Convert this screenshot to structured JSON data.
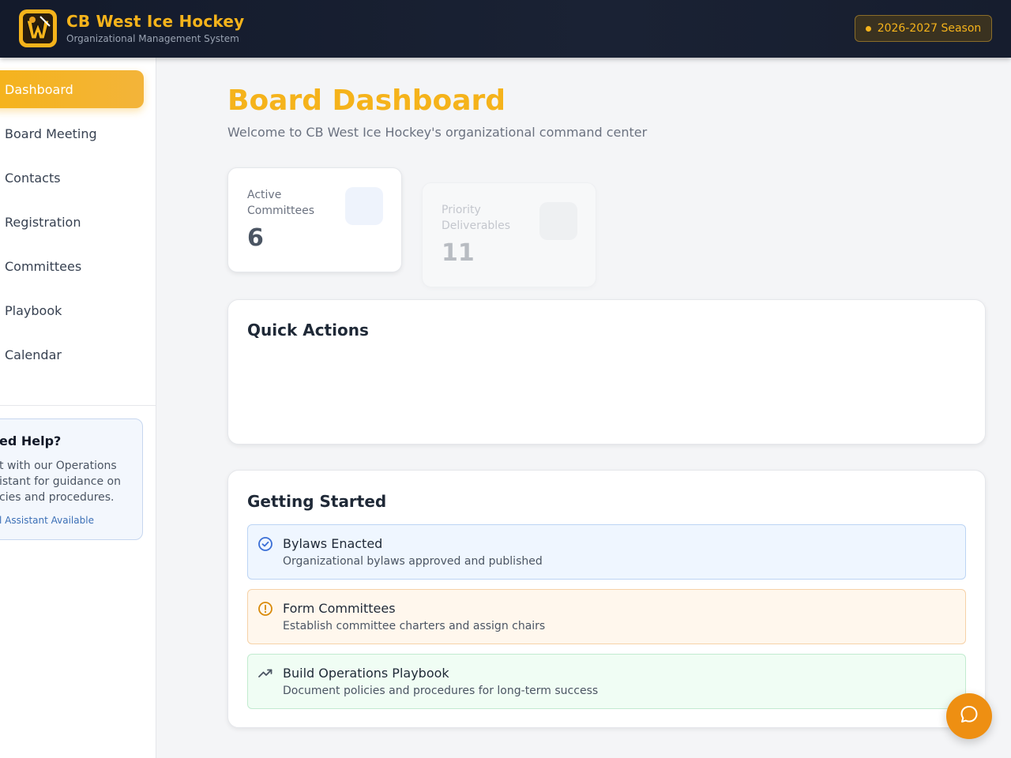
{
  "header": {
    "title": "CB West Ice Hockey",
    "subtitle": "Organizational Management System",
    "season": "2026-2027 Season"
  },
  "sidebar": {
    "items": [
      {
        "label": "Dashboard",
        "active": true
      },
      {
        "label": "Board Meeting"
      },
      {
        "label": "Contacts"
      },
      {
        "label": "Registration"
      },
      {
        "label": "Committees"
      },
      {
        "label": "Playbook"
      },
      {
        "label": "Calendar"
      }
    ],
    "help": {
      "title": "ed Help?",
      "text": "t with our Operations istant for guidance on cies and procedures.",
      "link": "l Assistant Available"
    }
  },
  "main": {
    "title": "Board Dashboard",
    "subtitle": "Welcome to CB West Ice Hockey's organizational command center",
    "stats": [
      {
        "label": "Active Committees",
        "value": "6"
      },
      {
        "label": "Priority Deliverables",
        "value": "11"
      }
    ],
    "quick_actions": {
      "title": "Quick Actions"
    },
    "getting_started": {
      "title": "Getting Started",
      "tasks": [
        {
          "title": "Bylaws Enacted",
          "desc": "Organizational bylaws approved and published",
          "icon": "check-circle-icon"
        },
        {
          "title": "Form Committees",
          "desc": "Establish committee charters and assign chairs",
          "icon": "alert-circle-icon"
        },
        {
          "title": "Build Operations Playbook",
          "desc": "Document policies and procedures for long-term success",
          "icon": "trending-up-icon"
        }
      ]
    }
  },
  "colors": {
    "accent": "#f5b31b",
    "header_bg": "#131a2b",
    "chat_button": "#ee8f12"
  }
}
